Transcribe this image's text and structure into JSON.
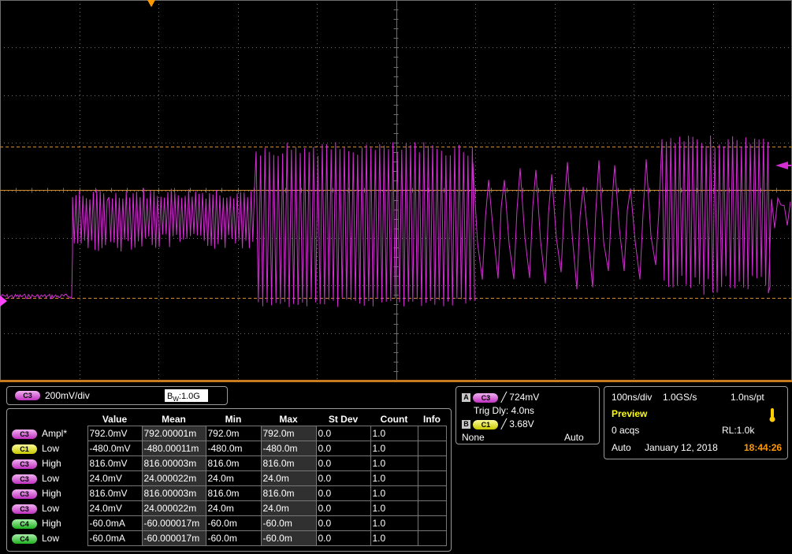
{
  "channel": {
    "badge": "C3",
    "scale": "200mV/div",
    "bw_prefix": "B",
    "bw_sub": "W",
    "bw_value": ":1.0G"
  },
  "measurements": {
    "headers": [
      "Value",
      "Mean",
      "Min",
      "Max",
      "St Dev",
      "Count",
      "Info"
    ],
    "rows": [
      {
        "channel": "C3",
        "color": "magenta",
        "label": "Ampl*",
        "value": "792.0mV",
        "mean": "792.00001m",
        "min": "792.0m",
        "max": "792.0m",
        "stdev": "0.0",
        "count": "1.0",
        "info": ""
      },
      {
        "channel": "C1",
        "color": "yellow",
        "label": "Low",
        "value": "-480.0mV",
        "mean": "-480.00011m",
        "min": "-480.0m",
        "max": "-480.0m",
        "stdev": "0.0",
        "count": "1.0",
        "info": ""
      },
      {
        "channel": "C3",
        "color": "magenta",
        "label": "High",
        "value": "816.0mV",
        "mean": "816.00003m",
        "min": "816.0m",
        "max": "816.0m",
        "stdev": "0.0",
        "count": "1.0",
        "info": ""
      },
      {
        "channel": "C3",
        "color": "magenta",
        "label": "Low",
        "value": "24.0mV",
        "mean": "24.000022m",
        "min": "24.0m",
        "max": "24.0m",
        "stdev": "0.0",
        "count": "1.0",
        "info": ""
      },
      {
        "channel": "C3",
        "color": "magenta",
        "label": "High",
        "value": "816.0mV",
        "mean": "816.00003m",
        "min": "816.0m",
        "max": "816.0m",
        "stdev": "0.0",
        "count": "1.0",
        "info": ""
      },
      {
        "channel": "C3",
        "color": "magenta",
        "label": "Low",
        "value": "24.0mV",
        "mean": "24.000022m",
        "min": "24.0m",
        "max": "24.0m",
        "stdev": "0.0",
        "count": "1.0",
        "info": ""
      },
      {
        "channel": "C4",
        "color": "green",
        "label": "High",
        "value": "-60.0mA",
        "mean": "-60.000017m",
        "min": "-60.0m",
        "max": "-60.0m",
        "stdev": "0.0",
        "count": "1.0",
        "info": ""
      },
      {
        "channel": "C4",
        "color": "green",
        "label": "Low",
        "value": "-60.0mA",
        "mean": "-60.000017m",
        "min": "-60.0m",
        "max": "-60.0m",
        "stdev": "0.0",
        "count": "1.0",
        "info": ""
      }
    ]
  },
  "trigger": {
    "a_label": "A",
    "a_channel": "C3",
    "a_level": "724mV",
    "delay": "Trig Dly: 4.0ns",
    "b_label": "B",
    "b_channel": "C1",
    "b_level": "3.68V",
    "mode_left": "None",
    "mode_right": "Auto"
  },
  "horizontal": {
    "timebase": "100ns/div",
    "sample_rate": "1.0GS/s",
    "resolution": "1.0ns/pt",
    "state": "Preview",
    "acqs": "0 acqs",
    "record_length": "RL:1.0k",
    "acq_mode": "Auto",
    "date": "January 12, 2018",
    "time": "18:44:26"
  },
  "colors": {
    "trace": "#d22fd2",
    "grid": "#6e6e6e",
    "cursor": "#d08a2a",
    "accent_orange": "#ff9900",
    "preview_yellow": "#ffff00"
  },
  "icons": {
    "trigger_marker": "down-triangle-icon",
    "level_marker": "left-arrow-icon",
    "ground_marker": "right-arrow-icon",
    "preview_marker": "thermometer-icon"
  }
}
